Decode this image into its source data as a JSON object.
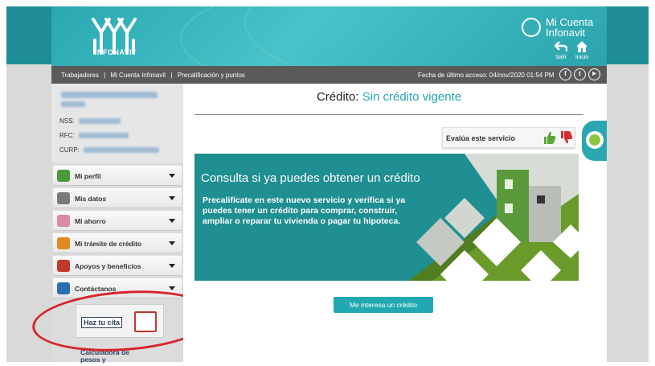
{
  "header": {
    "logo_text": "INFONAVIT",
    "mi_cuenta_line1": "Mi Cuenta",
    "mi_cuenta_line2": "Infonavit",
    "salir_label": "Salir",
    "inicio_label": "Inicio"
  },
  "navbar": {
    "breadcrumbs": [
      "Trabajadores",
      "|",
      "Mi Cuenta Infonavit",
      "|",
      "Precalificación y puntos"
    ],
    "last_access": "Fecha de último acceso: 04/nov/2020 01:54 PM",
    "social": [
      "f",
      "t",
      "▶"
    ]
  },
  "sidebar": {
    "nss_label": "NSS:",
    "rfc_label": "RFC:",
    "curp_label": "CURP:",
    "menu": [
      {
        "label": "Mi perfil",
        "icon": "person-icon",
        "color": "#4a9a3a"
      },
      {
        "label": "Mis datos",
        "icon": "data-icon",
        "color": "#7a7a7a"
      },
      {
        "label": "Mi ahorro",
        "icon": "piggy-bank-icon",
        "color": "#d98aa0"
      },
      {
        "label": "Mi trámite de crédito",
        "icon": "folder-icon",
        "color": "#e08a1e"
      },
      {
        "label": "Apoyos y beneficios",
        "icon": "gift-icon",
        "color": "#c0392b"
      },
      {
        "label": "Contáctanos",
        "icon": "contact-icon",
        "color": "#2a6fb0"
      }
    ],
    "cita_label": "Haz tu cita",
    "calc_line1": "Calculadora de",
    "calc_line2": "pesos y"
  },
  "main": {
    "credit_label": "Crédito:",
    "credit_value": "Sin crédito vigente",
    "evalua_label": "Evalúa este servicio",
    "banner_title": "Consulta si ya puedes obtener un crédito",
    "banner_desc": "Precalifícate en este nuevo servicio y verifica si ya puedes tener un crédito para comprar, construir, ampliar o reparar tu vivienda o pagar tu hipoteca.",
    "button_label": "Me interesa un crédito"
  },
  "colors": {
    "teal": "#2aa7b0",
    "dark_nav": "#5a5a5a",
    "banner": "#1f8f92",
    "annotation_red": "#d6242b"
  }
}
